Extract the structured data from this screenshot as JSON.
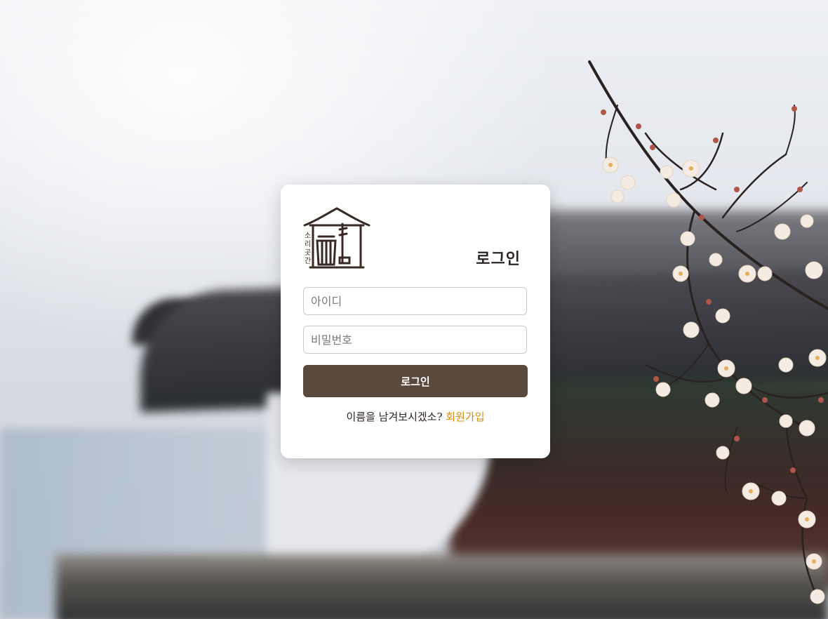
{
  "logo": {
    "icon": "hanok-instrument-logo",
    "text": "소리곳간"
  },
  "login": {
    "title": "로그인",
    "id_placeholder": "아이디",
    "id_value": "",
    "password_placeholder": "비밀번호",
    "password_value": "",
    "submit_label": "로그인"
  },
  "signup": {
    "prompt": "이름을 남겨보시겠소?",
    "link_label": "회원가입"
  },
  "colors": {
    "button": "#5a4a3d",
    "link": "#d98a10",
    "card": "#ffffff"
  }
}
